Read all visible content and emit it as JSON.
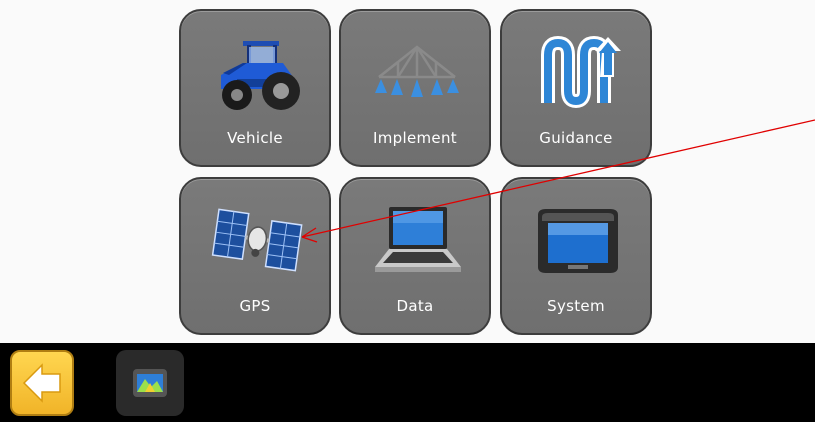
{
  "menu": {
    "tiles": [
      {
        "label": "Vehicle",
        "icon": "tractor-icon"
      },
      {
        "label": "Implement",
        "icon": "sprayer-boom-icon"
      },
      {
        "label": "Guidance",
        "icon": "guidance-pattern-icon"
      },
      {
        "label": "GPS",
        "icon": "satellite-icon"
      },
      {
        "label": "Data",
        "icon": "laptop-icon"
      },
      {
        "label": "System",
        "icon": "display-console-icon"
      }
    ]
  },
  "bottom_bar": {
    "back_icon": "back-arrow-icon",
    "display_icon": "display-mini-icon"
  },
  "colors": {
    "tile": "#727272",
    "tile_border": "#3d3d3d",
    "bottom_bar": "#000000",
    "back_button": "#f5bf33",
    "annotation_arrow": "#e00000"
  }
}
